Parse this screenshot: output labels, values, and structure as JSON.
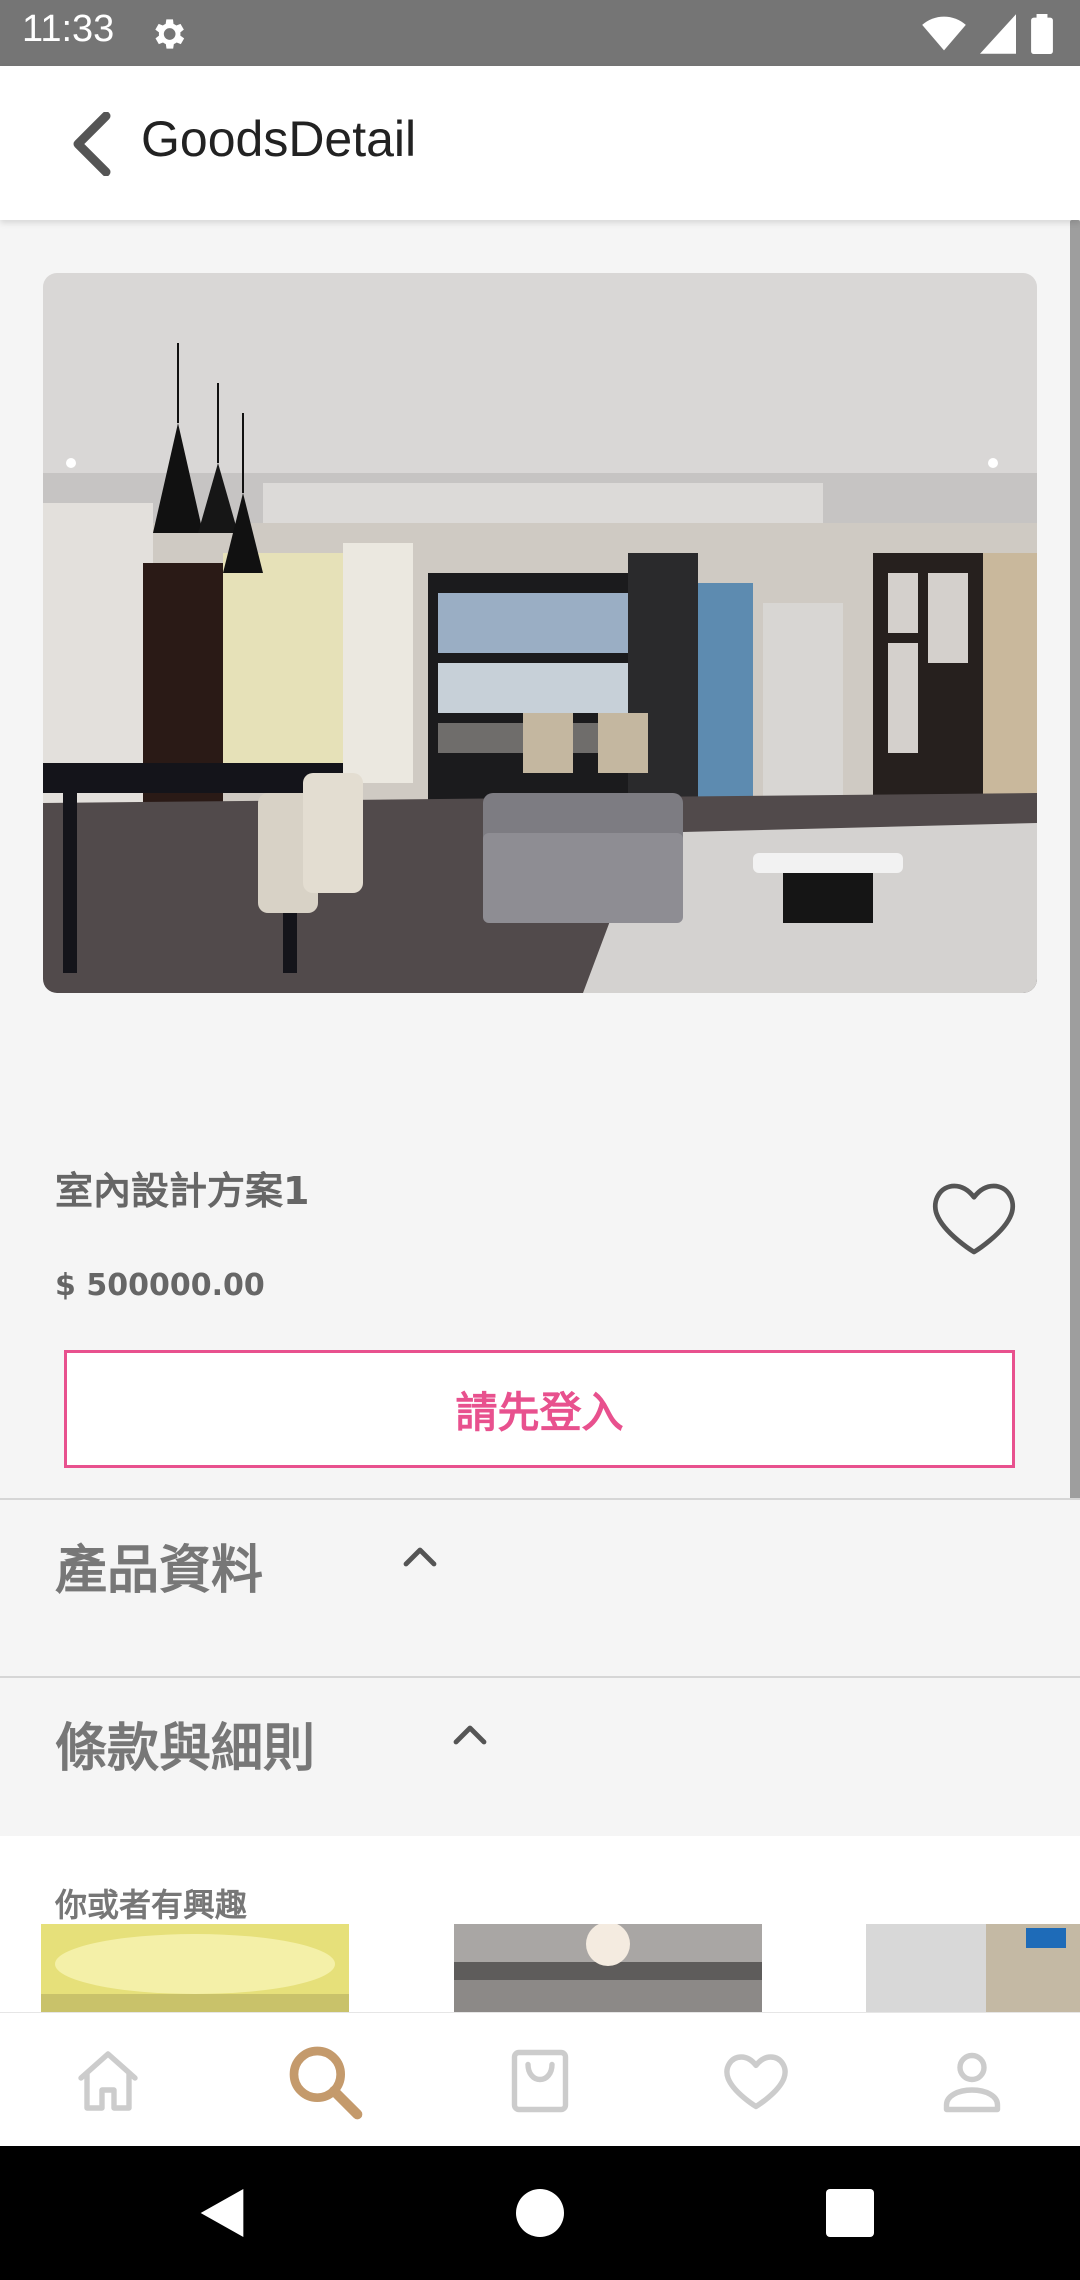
{
  "status_bar": {
    "time": "11:33",
    "icons": [
      "gear-icon",
      "wifi-icon",
      "signal-icon",
      "battery-icon"
    ]
  },
  "app_bar": {
    "title": "GoodsDetail",
    "back_icon": "back-arrow-icon"
  },
  "product": {
    "image": "interior-living-room-photo",
    "name": "室內設計方案1",
    "price": "$ 500000.00",
    "favorite_icon": "heart-outline-icon"
  },
  "login_button": {
    "label": "請先登入"
  },
  "sections": [
    {
      "title": "產品資料",
      "icon": "chevron-up-icon"
    },
    {
      "title": "條款與細則",
      "icon": "chevron-up-icon"
    }
  ],
  "recommendations": {
    "title": "你或者有興趣"
  },
  "bottom_nav": {
    "items": [
      {
        "name": "home",
        "icon": "home-icon",
        "active": false
      },
      {
        "name": "search",
        "icon": "search-icon",
        "active": true
      },
      {
        "name": "cart",
        "icon": "shopping-bag-icon",
        "active": false
      },
      {
        "name": "favorites",
        "icon": "heart-icon",
        "active": false
      },
      {
        "name": "profile",
        "icon": "person-icon",
        "active": false
      }
    ]
  },
  "colors": {
    "accent": "#e8518e",
    "nav_active": "#c49a6c",
    "nav_inactive": "#cccccc",
    "status_bar": "#757575"
  },
  "system_nav": {
    "icons": [
      "back-triangle-icon",
      "home-circle-icon",
      "recents-square-icon"
    ]
  }
}
